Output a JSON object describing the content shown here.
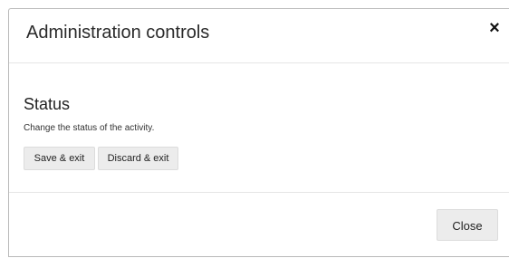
{
  "dialog": {
    "title": "Administration controls",
    "close_icon_glyph": "×"
  },
  "status_section": {
    "heading": "Status",
    "description": "Change the status of the activity.",
    "save_exit_label": "Save & exit",
    "discard_exit_label": "Discard & exit"
  },
  "footer": {
    "close_label": "Close"
  },
  "colors": {
    "button_background": "#ececec",
    "divider": "#e5e5e5",
    "border": "#b9b9b9"
  }
}
